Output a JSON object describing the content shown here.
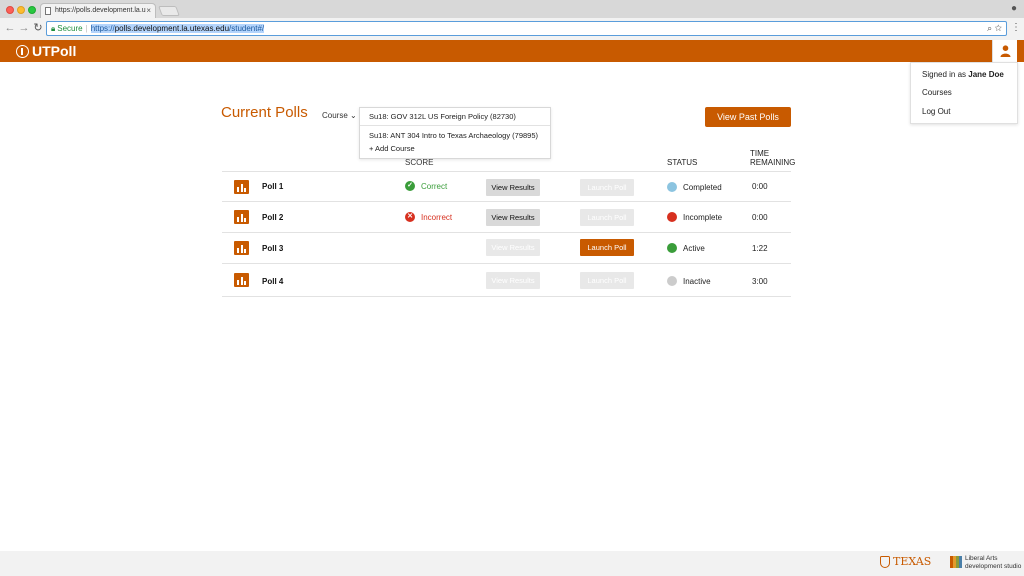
{
  "browser": {
    "tab_title": "https://polls.development.la.u",
    "secure_label": "Secure",
    "url_scheme": "https://",
    "url_host": "polls.development.la.utexas.edu",
    "url_path": "/student#/"
  },
  "app": {
    "brand": "UTPoll"
  },
  "user_menu": {
    "signed_in_prefix": "Signed in as ",
    "user_name": "Jane Doe",
    "courses": "Courses",
    "logout": "Log Out"
  },
  "main": {
    "title": "Current Polls",
    "course_label": "Course",
    "course_options": [
      "Su18: GOV 312L US Foreign Policy (82730)",
      "Su18: ANT 304 Intro to Texas Archaeology (79895)"
    ],
    "add_course": "+ Add Course",
    "view_past_button": "View Past Polls"
  },
  "table": {
    "headers": {
      "score": "SCORE",
      "status": "STATUS",
      "time_line1": "TIME",
      "time_line2": "REMAINING"
    },
    "rows": [
      {
        "name": "Poll 1",
        "score": "Correct",
        "view": "View Results",
        "launch": "Launch Poll",
        "status": "Completed",
        "time": "0:00"
      },
      {
        "name": "Poll 2",
        "score": "Incorrect",
        "view": "View Results",
        "launch": "Launch Poll",
        "status": "Incomplete",
        "time": "0:00"
      },
      {
        "name": "Poll 3",
        "score": "",
        "view": "View Results",
        "launch": "Launch Poll",
        "status": "Active",
        "time": "1:22"
      },
      {
        "name": "Poll 4",
        "score": "",
        "view": "View Results",
        "launch": "Launch Poll",
        "status": "Inactive",
        "time": "3:00"
      }
    ]
  },
  "status_colors": {
    "completed": "#8cc4e0",
    "incomplete": "#d7301f",
    "active": "#3a9d3a",
    "inactive": "#cccccc"
  },
  "accent_color": "#c85a00",
  "footer": {
    "texas": "TEXAS",
    "la_line1": "Liberal Arts",
    "la_line2": "development studio"
  }
}
